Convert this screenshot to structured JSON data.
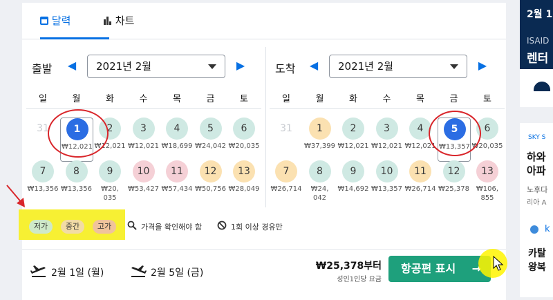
{
  "tabs": [
    {
      "label": "달력",
      "icon": "calendar-icon"
    },
    {
      "label": "차트",
      "icon": "bar-chart-icon"
    }
  ],
  "departure": {
    "label": "출발",
    "month": "2021년 2월",
    "weekdays": [
      "일",
      "월",
      "화",
      "수",
      "목",
      "금",
      "토"
    ],
    "days": [
      {
        "day": "31",
        "price": "",
        "level": "disabled"
      },
      {
        "day": "1",
        "price": "₩12,021",
        "level": "selected"
      },
      {
        "day": "2",
        "price": "₩12,021",
        "level": "low"
      },
      {
        "day": "3",
        "price": "₩12,021",
        "level": "low"
      },
      {
        "day": "4",
        "price": "₩18,699",
        "level": "low"
      },
      {
        "day": "5",
        "price": "₩24,042",
        "level": "low"
      },
      {
        "day": "6",
        "price": "₩20,035",
        "level": "low"
      },
      {
        "day": "7",
        "price": "₩13,356",
        "level": "low"
      },
      {
        "day": "8",
        "price": "₩13,356",
        "level": "low"
      },
      {
        "day": "9",
        "price": "₩20,\n035",
        "level": "low"
      },
      {
        "day": "10",
        "price": "₩53,427",
        "level": "high"
      },
      {
        "day": "11",
        "price": "₩57,434",
        "level": "high"
      },
      {
        "day": "12",
        "price": "₩50,756",
        "level": "mid"
      },
      {
        "day": "13",
        "price": "₩28,049",
        "level": "mid"
      }
    ]
  },
  "arrival": {
    "label": "도착",
    "month": "2021년 2월",
    "weekdays": [
      "일",
      "월",
      "화",
      "수",
      "목",
      "금",
      "토"
    ],
    "days": [
      {
        "day": "31",
        "price": "",
        "level": "disabled"
      },
      {
        "day": "1",
        "price": "₩37,399",
        "level": "mid"
      },
      {
        "day": "2",
        "price": "₩12,021",
        "level": "low"
      },
      {
        "day": "3",
        "price": "₩12,021",
        "level": "low"
      },
      {
        "day": "4",
        "price": "₩12,021",
        "level": "low"
      },
      {
        "day": "5",
        "price": "₩13,357",
        "level": "selected"
      },
      {
        "day": "6",
        "price": "₩20,035",
        "level": "low"
      },
      {
        "day": "7",
        "price": "₩26,714",
        "level": "mid"
      },
      {
        "day": "8",
        "price": "₩24,\n042",
        "level": "low"
      },
      {
        "day": "9",
        "price": "₩14,692",
        "level": "low"
      },
      {
        "day": "10",
        "price": "₩13,357",
        "level": "low"
      },
      {
        "day": "11",
        "price": "₩26,714",
        "level": "mid"
      },
      {
        "day": "12",
        "price": "₩25,378",
        "level": "low"
      },
      {
        "day": "13",
        "price": "₩106,\n855",
        "level": "high"
      }
    ]
  },
  "legend": {
    "low": "저가",
    "mid": "중간",
    "high": "고가",
    "check_price": "가격을 확인해야 함",
    "stops": "1회 이상 경유만"
  },
  "colors": {
    "low": "#cfe9e3",
    "mid": "#fbe1b1",
    "high": "#f5d0d6",
    "selected": "#2b6de3",
    "accent": "#0770e3",
    "cta": "#1ea07c",
    "annotation": "#d9262b"
  },
  "summary": {
    "outbound": "2월 1일 (월)",
    "inbound": "2월 5일 (금)",
    "price": "₩25,378부터",
    "price_note": "성인1인당 요금",
    "cta": "항공편 표시"
  },
  "side": {
    "card1_date": "2월 1",
    "card1_brand": "ISAID",
    "card1_title": "렌터",
    "card2_label": "SKY S",
    "card2_line1": "하와",
    "card2_line2": "아파",
    "card2_line3": "노후다",
    "card2_line4": "리아 A",
    "card3_label": "k",
    "card3_line1": "카탈",
    "card3_line2": "왕복"
  }
}
